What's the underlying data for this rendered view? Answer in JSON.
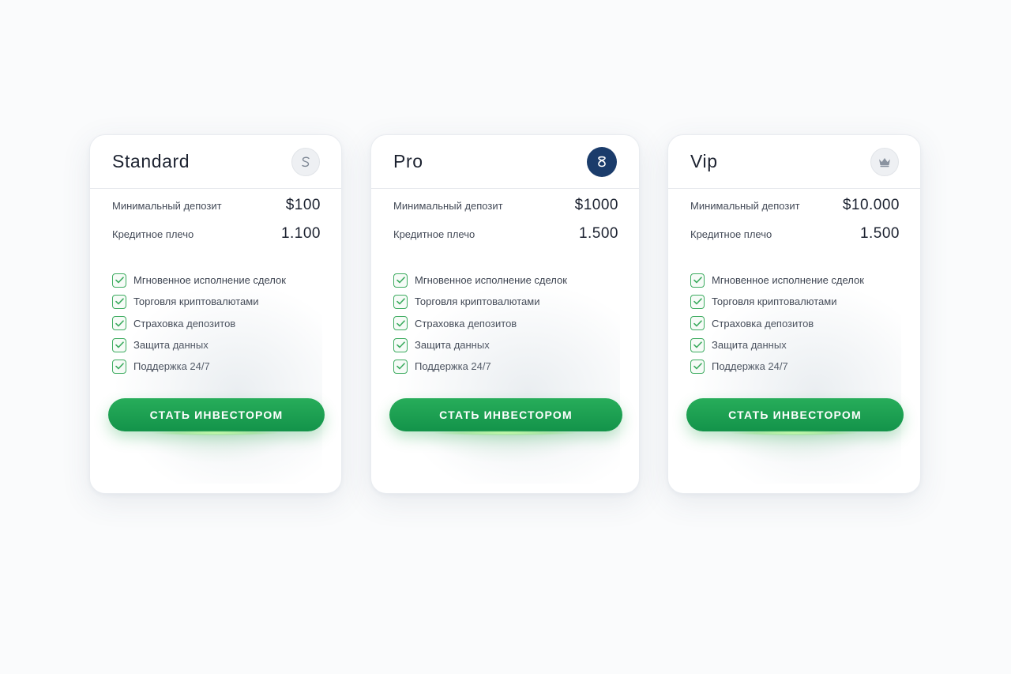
{
  "plans": [
    {
      "name": "Standard",
      "icon": "swirl-icon",
      "stats": [
        {
          "label": "Минимальный депозит",
          "value": "$100"
        },
        {
          "label": "Кредитное плечо",
          "value": "1.100"
        }
      ],
      "features": [
        "Мгновенное исполнение сделок",
        "Торговля криптовалютами",
        "Страховка депозитов",
        "Защита данных",
        "Поддержка 24/7"
      ],
      "cta": "СТАТЬ ИНВЕСТОРОМ"
    },
    {
      "name": "Pro",
      "icon": "infinity-knot-icon",
      "stats": [
        {
          "label": "Минимальный депозит",
          "value": "$1000"
        },
        {
          "label": "Кредитное плечо",
          "value": "1.500"
        }
      ],
      "features": [
        "Мгновенное исполнение сделок",
        "Торговля криптовалютами",
        "Страховка депозитов",
        "Защита данных",
        "Поддержка 24/7"
      ],
      "cta": "СТАТЬ ИНВЕСТОРОМ"
    },
    {
      "name": "Vip",
      "icon": "crown-icon",
      "stats": [
        {
          "label": "Минимальный депозит",
          "value": "$10.000"
        },
        {
          "label": "Кредитное плечо",
          "value": "1.500"
        }
      ],
      "features": [
        "Мгновенное исполнение сделок",
        "Торговля криптовалютами",
        "Страховка депозитов",
        "Защита данных",
        "Поддержка 24/7"
      ],
      "cta": "СТАТЬ ИНВЕСТОРОМ"
    }
  ],
  "colors": {
    "accent_green": "#1a9e50",
    "check_green": "#3cab5f",
    "pro_icon_navy": "#1b3c6b"
  }
}
